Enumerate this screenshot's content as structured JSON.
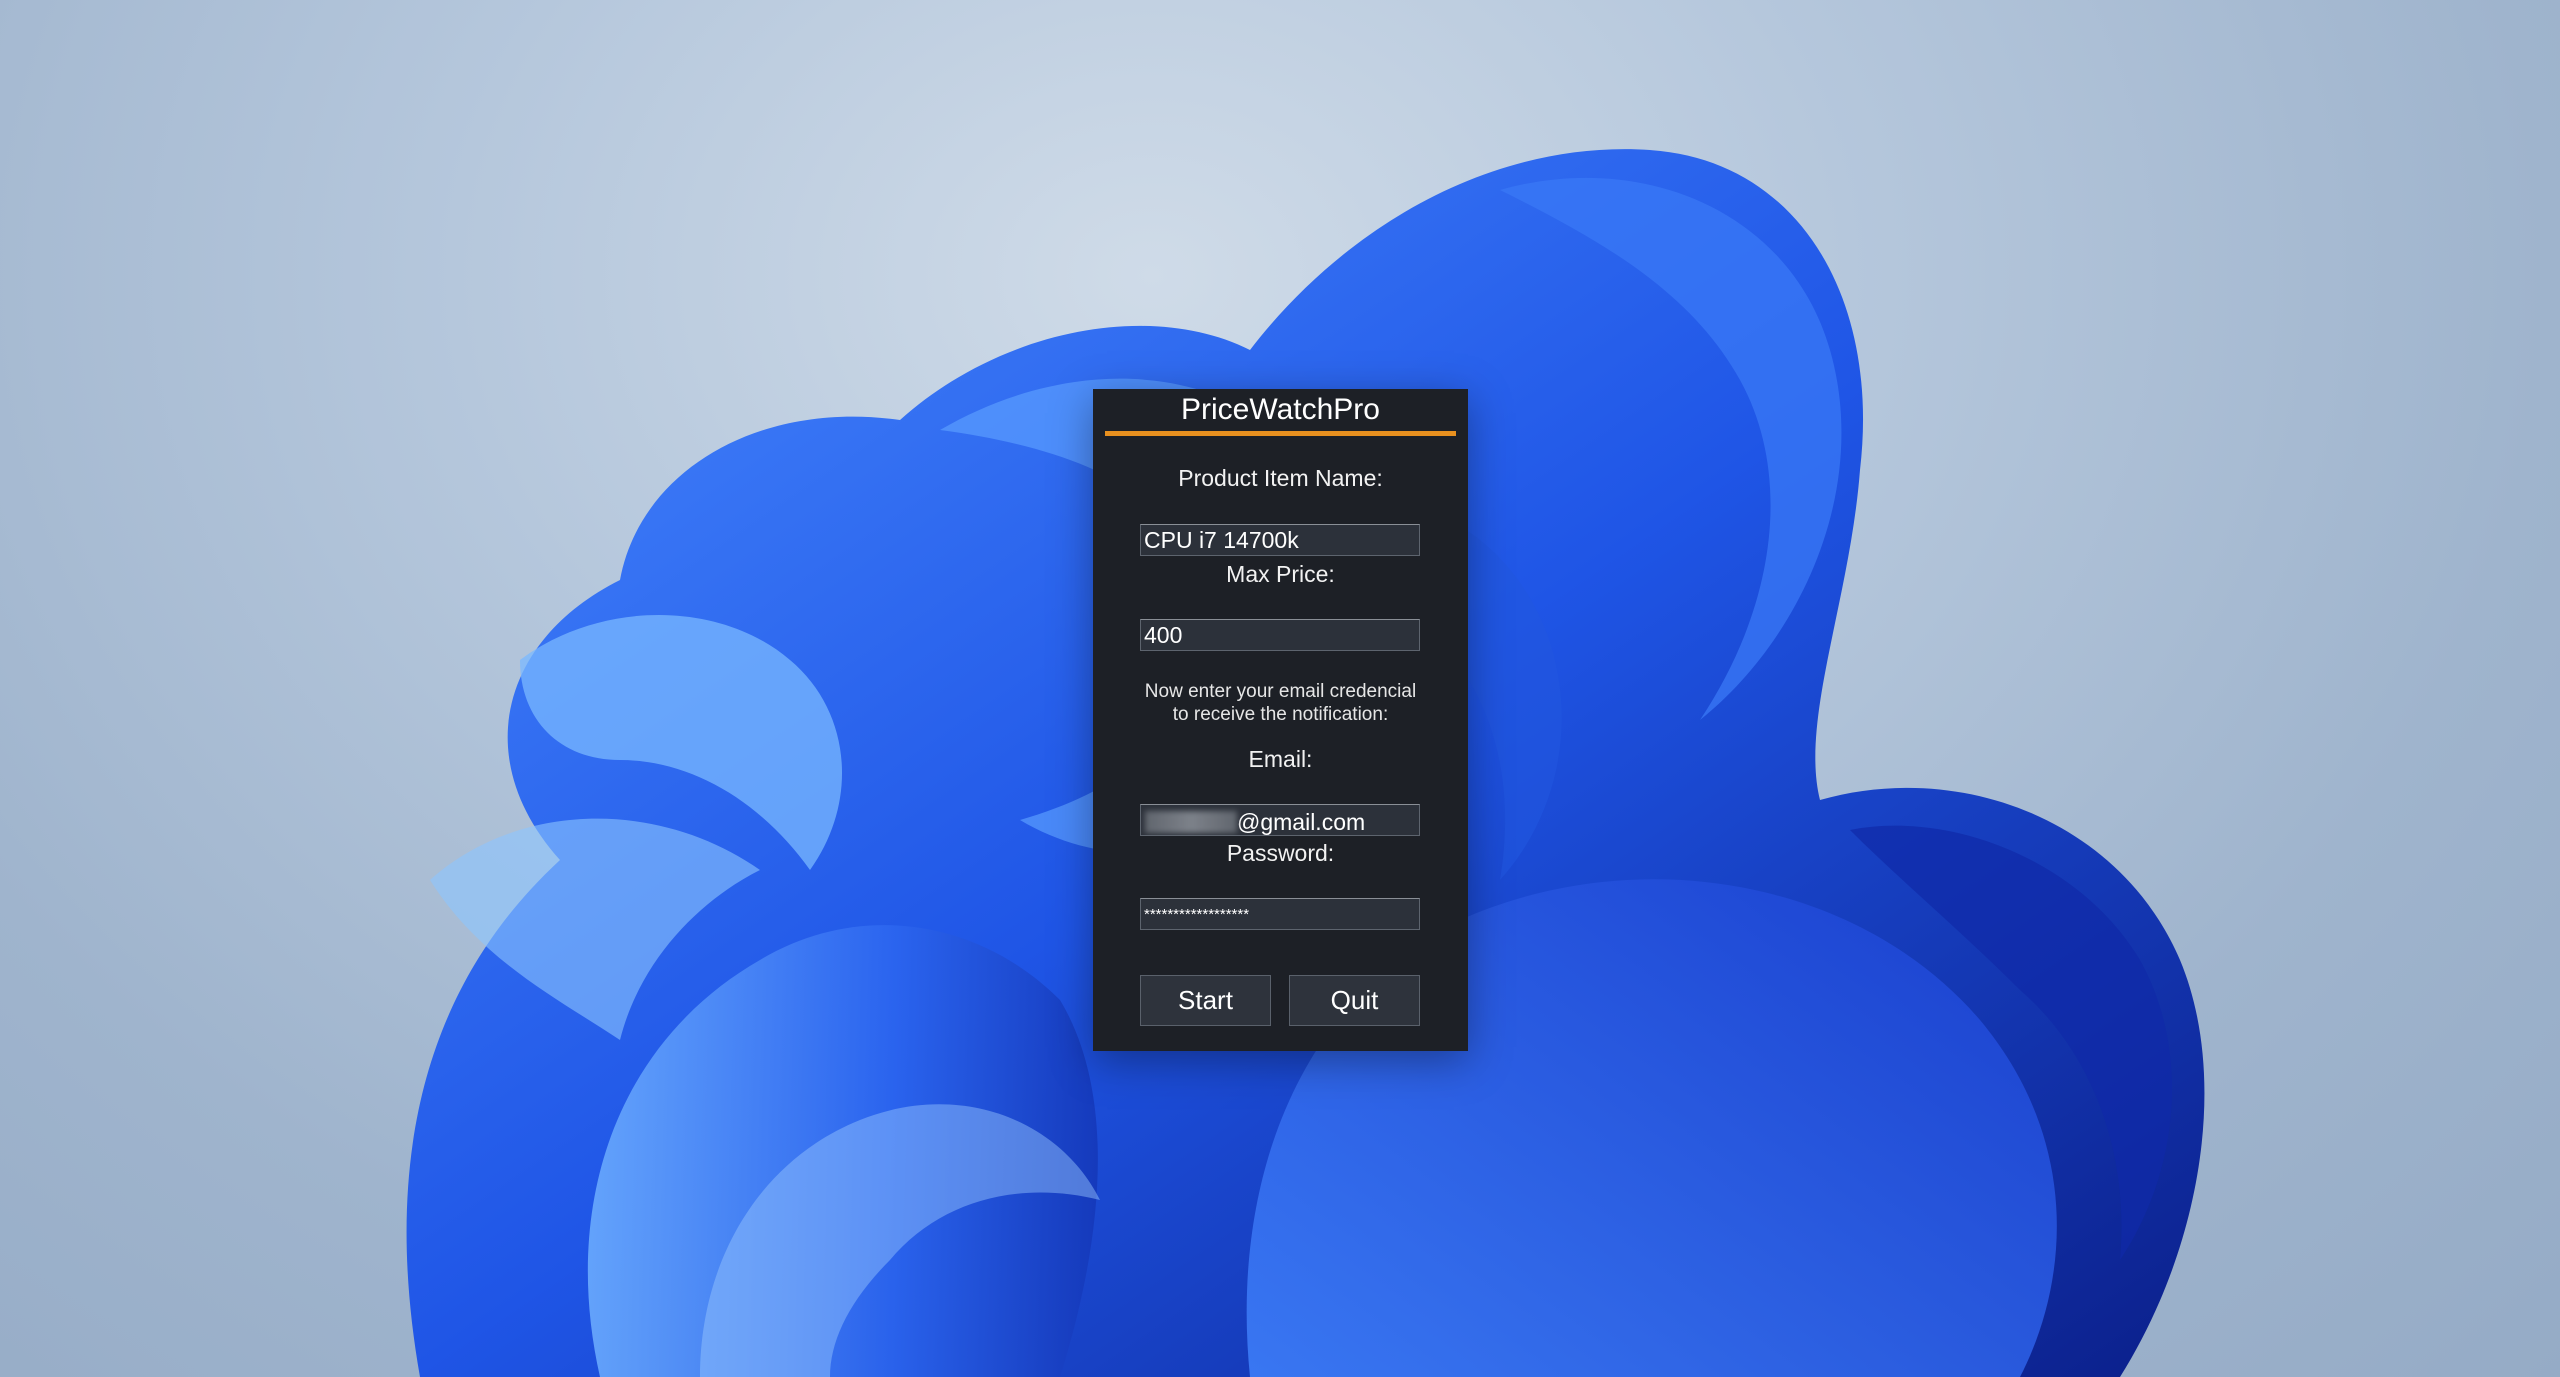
{
  "app": {
    "title": "PriceWatchPro",
    "accent_color": "#e8901f"
  },
  "form": {
    "product_label": "Product Item Name:",
    "product_value": "CPU i7 14700k",
    "price_label": "Max Price:",
    "price_value": "400",
    "info_line1": "Now  enter your email credencial",
    "info_line2": "to receive the notification:",
    "email_label": "Email:",
    "email_domain": "@gmail.com",
    "password_label": "Password:",
    "password_value": "******************"
  },
  "buttons": {
    "start_label": "Start",
    "quit_label": "Quit"
  }
}
